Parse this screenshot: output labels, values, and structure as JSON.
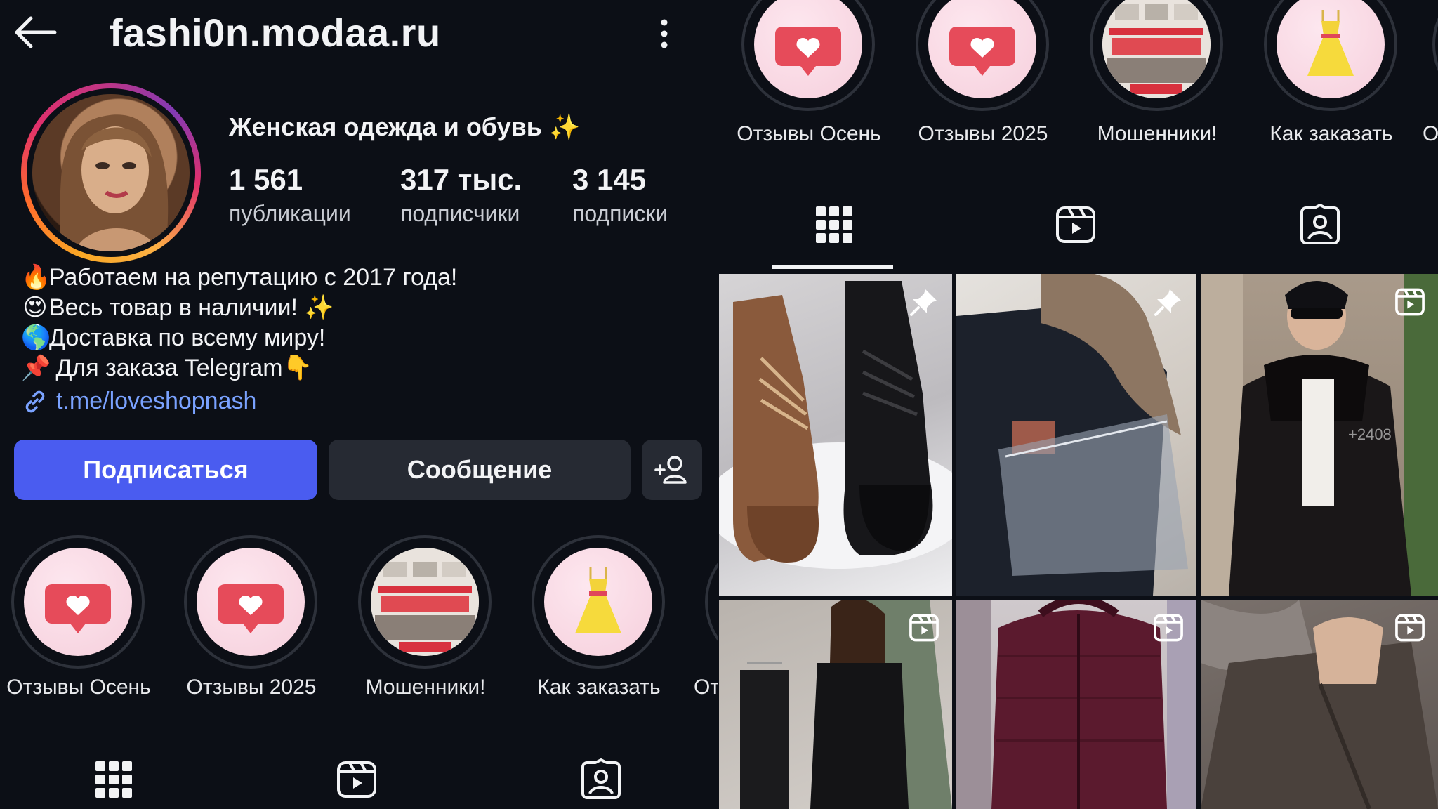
{
  "header": {
    "username": "fashi0n.modaa.ru"
  },
  "profile": {
    "display_name": "Женская одежда и обувь ✨",
    "stats": [
      {
        "num": "1 561",
        "label": "публикации"
      },
      {
        "num": "317 тыс.",
        "label": "подписчики"
      },
      {
        "num": "3 145",
        "label": "подписки"
      }
    ],
    "bio": [
      {
        "emoji": "🔥",
        "text": "Работаем на репутацию с 2017 года!"
      },
      {
        "emoji": "😍",
        "text": "Весь товар в наличии! ✨"
      },
      {
        "emoji": "🌎",
        "text": "Доставка по всему миру!"
      },
      {
        "emoji": "📌",
        "text": " Для заказа Telegram👇"
      }
    ],
    "link": "t.me/loveshopnash"
  },
  "actions": {
    "follow": "Подписаться",
    "message": "Сообщение"
  },
  "highlights": [
    {
      "label": "Отзывы Осень",
      "icon": "heart-bubble-icon"
    },
    {
      "label": "Отзывы 2025",
      "icon": "heart-bubble-icon"
    },
    {
      "label": "Мошенники!",
      "icon": "collage-thumbnail"
    },
    {
      "label": "Как заказать",
      "icon": "dress-icon"
    },
    {
      "label": "От",
      "icon": "partial"
    }
  ],
  "tabs": [
    {
      "name": "grid-tab",
      "icon": "grid-icon"
    },
    {
      "name": "reels-tab",
      "icon": "reels-icon"
    },
    {
      "name": "tagged-tab",
      "icon": "tagged-icon"
    }
  ],
  "posts": [
    {
      "subject": "boots",
      "badge": "pin-icon"
    },
    {
      "subject": "fur-jacket",
      "badge": "pin-icon"
    },
    {
      "subject": "black-coat",
      "badge": "reels-icon",
      "overlay_text": "+2408"
    },
    {
      "subject": "black-suit",
      "badge": "reels-icon"
    },
    {
      "subject": "burgundy-vest",
      "badge": "reels-icon"
    },
    {
      "subject": "fur-coat",
      "badge": "reels-icon"
    }
  ],
  "colors": {
    "background": "#0c0f16",
    "follow_button": "#4a5cf0",
    "button_dark": "#262a33",
    "link": "#7aa2ff"
  }
}
